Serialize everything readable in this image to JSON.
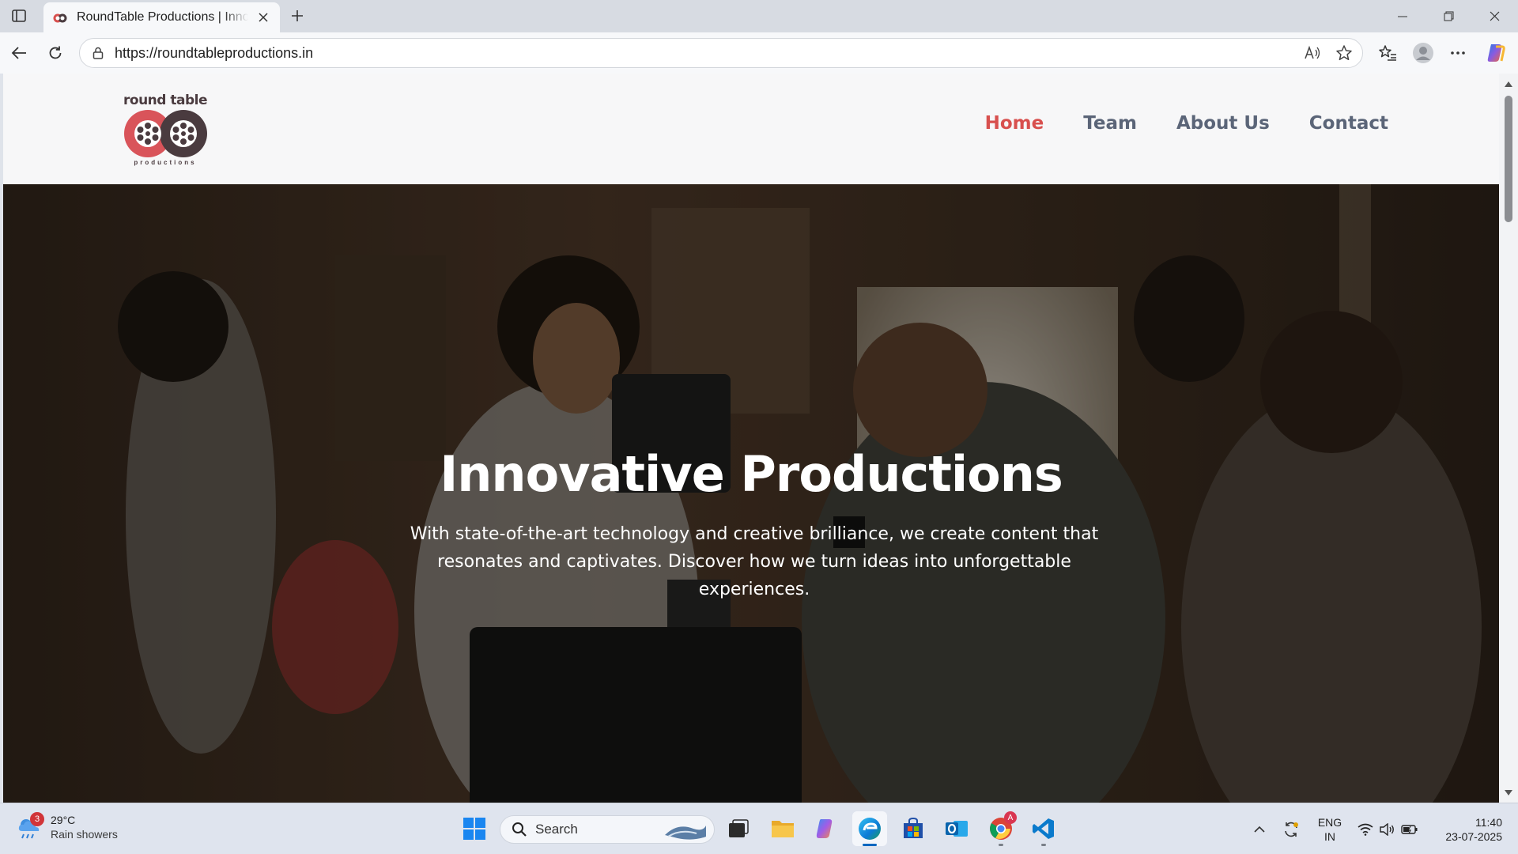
{
  "browser": {
    "tab_title": "RoundTable Productions | Innovative Productions",
    "url": "https://roundtableproductions.in"
  },
  "site": {
    "logo_word": "round table",
    "logo_sub": "productions",
    "nav": [
      {
        "label": "Home",
        "active": true
      },
      {
        "label": "Team",
        "active": false
      },
      {
        "label": "About Us",
        "active": false
      },
      {
        "label": "Contact",
        "active": false
      }
    ],
    "hero": {
      "title": "Innovative Productions",
      "text": "With state-of-the-art technology and creative brilliance, we create content that resonates and captivates. Discover how we turn ideas into unforgettable experiences."
    },
    "colors": {
      "accent": "#d8504e",
      "nav_text": "#5b6578"
    }
  },
  "taskbar": {
    "weather": {
      "badge": "3",
      "temp": "29°C",
      "desc": "Rain showers"
    },
    "search_label": "Search",
    "lang_line1": "ENG",
    "lang_line2": "IN",
    "time": "11:40",
    "date": "23-07-2025",
    "chrome_badge": "A"
  }
}
